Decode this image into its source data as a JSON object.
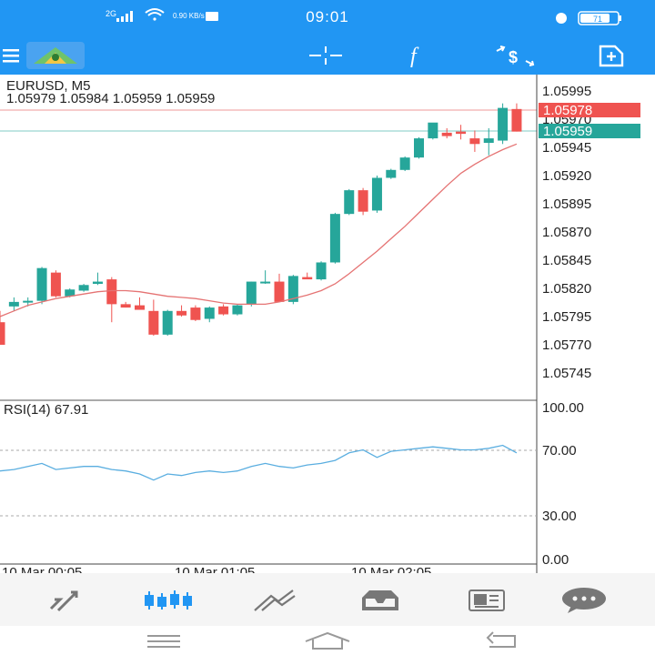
{
  "status_bar": {
    "time": "09:01",
    "network": "2G",
    "speed": "0.90 KB/s",
    "battery": "71"
  },
  "toolbar": {
    "items": [
      {
        "name": "menu-icon"
      },
      {
        "name": "app-logo"
      },
      {
        "name": "crosshair-icon"
      },
      {
        "name": "indicators-icon"
      },
      {
        "name": "trade-icon"
      },
      {
        "name": "add-chart-icon"
      }
    ]
  },
  "chart_header": {
    "symbol": "EURUSD, M5",
    "ohlc": "1.05979 1.05984 1.05959 1.05959"
  },
  "chart_data": [
    {
      "type": "candlestick",
      "title": "EURUSD, M5",
      "y_ticks": [
        "1.05995",
        "1.05970",
        "1.05945",
        "1.05920",
        "1.05895",
        "1.05870",
        "1.05845",
        "1.05820",
        "1.05795",
        "1.05770",
        "1.05745"
      ],
      "ylim": [
        1.05725,
        1.0601
      ],
      "x_labels": [
        "10 Mar 00:05",
        "10 Mar 01:05",
        "10 Mar 02:05"
      ],
      "price_labels": [
        {
          "value": "1.05978",
          "color": "#ef5350"
        },
        {
          "value": "1.05959",
          "color": "#26a69a"
        }
      ],
      "candles": [
        {
          "o": 1.0579,
          "h": 1.058,
          "l": 1.0577,
          "c": 1.0577
        },
        {
          "o": 1.05804,
          "h": 1.05812,
          "l": 1.058,
          "c": 1.05808
        },
        {
          "o": 1.05808,
          "h": 1.05812,
          "l": 1.05804,
          "c": 1.05809
        },
        {
          "o": 1.05809,
          "h": 1.05839,
          "l": 1.05806,
          "c": 1.05838
        },
        {
          "o": 1.05834,
          "h": 1.05836,
          "l": 1.05812,
          "c": 1.05813
        },
        {
          "o": 1.05813,
          "h": 1.0582,
          "l": 1.05812,
          "c": 1.05819
        },
        {
          "o": 1.05818,
          "h": 1.05824,
          "l": 1.05817,
          "c": 1.05823
        },
        {
          "o": 1.05824,
          "h": 1.05834,
          "l": 1.05823,
          "c": 1.05826
        },
        {
          "o": 1.05828,
          "h": 1.0583,
          "l": 1.0579,
          "c": 1.05806
        },
        {
          "o": 1.05806,
          "h": 1.05808,
          "l": 1.05803,
          "c": 1.05803
        },
        {
          "o": 1.05805,
          "h": 1.05812,
          "l": 1.05802,
          "c": 1.05801
        },
        {
          "o": 1.058,
          "h": 1.0581,
          "l": 1.05778,
          "c": 1.05779
        },
        {
          "o": 1.05779,
          "h": 1.05801,
          "l": 1.05778,
          "c": 1.058
        },
        {
          "o": 1.058,
          "h": 1.05805,
          "l": 1.05795,
          "c": 1.05796
        },
        {
          "o": 1.05803,
          "h": 1.05805,
          "l": 1.05791,
          "c": 1.05792
        },
        {
          "o": 1.05793,
          "h": 1.05804,
          "l": 1.0579,
          "c": 1.05803
        },
        {
          "o": 1.05804,
          "h": 1.05806,
          "l": 1.05796,
          "c": 1.05797
        },
        {
          "o": 1.05797,
          "h": 1.05806,
          "l": 1.05796,
          "c": 1.05805
        },
        {
          "o": 1.05806,
          "h": 1.05826,
          "l": 1.05804,
          "c": 1.05826
        },
        {
          "o": 1.05826,
          "h": 1.05836,
          "l": 1.05824,
          "c": 1.05826
        },
        {
          "o": 1.05826,
          "h": 1.05833,
          "l": 1.05809,
          "c": 1.05808
        },
        {
          "o": 1.05808,
          "h": 1.05832,
          "l": 1.05806,
          "c": 1.05831
        },
        {
          "o": 1.0583,
          "h": 1.05834,
          "l": 1.05829,
          "c": 1.05828
        },
        {
          "o": 1.05828,
          "h": 1.05844,
          "l": 1.05827,
          "c": 1.05843
        },
        {
          "o": 1.05843,
          "h": 1.05887,
          "l": 1.05842,
          "c": 1.05886
        },
        {
          "o": 1.05886,
          "h": 1.05908,
          "l": 1.05885,
          "c": 1.05907
        },
        {
          "o": 1.05907,
          "h": 1.05909,
          "l": 1.05885,
          "c": 1.05888
        },
        {
          "o": 1.05889,
          "h": 1.0592,
          "l": 1.05887,
          "c": 1.05918
        },
        {
          "o": 1.05918,
          "h": 1.05926,
          "l": 1.05917,
          "c": 1.05925
        },
        {
          "o": 1.05925,
          "h": 1.05937,
          "l": 1.05924,
          "c": 1.05936
        },
        {
          "o": 1.05936,
          "h": 1.05954,
          "l": 1.05935,
          "c": 1.05953
        },
        {
          "o": 1.05953,
          "h": 1.05966,
          "l": 1.05952,
          "c": 1.05967
        },
        {
          "o": 1.05958,
          "h": 1.05962,
          "l": 1.05953,
          "c": 1.05955
        },
        {
          "o": 1.05959,
          "h": 1.05965,
          "l": 1.05952,
          "c": 1.05957
        },
        {
          "o": 1.05953,
          "h": 1.0596,
          "l": 1.05941,
          "c": 1.05948
        },
        {
          "o": 1.05949,
          "h": 1.05962,
          "l": 1.05938,
          "c": 1.05953
        },
        {
          "o": 1.05951,
          "h": 1.05984,
          "l": 1.05948,
          "c": 1.0598
        },
        {
          "o": 1.05979,
          "h": 1.05984,
          "l": 1.05959,
          "c": 1.05959
        }
      ],
      "ma": [
        1.05795,
        1.058,
        1.05805,
        1.05808,
        1.05811,
        1.05813,
        1.05815,
        1.05817,
        1.05818,
        1.05818,
        1.05817,
        1.05815,
        1.05813,
        1.05812,
        1.05811,
        1.05809,
        1.05807,
        1.05806,
        1.05806,
        1.05806,
        1.05808,
        1.05811,
        1.05814,
        1.05818,
        1.05824,
        1.05833,
        1.05843,
        1.05853,
        1.05864,
        1.05875,
        1.05887,
        1.05899,
        1.05911,
        1.05922,
        1.0593,
        1.05937,
        1.05943,
        1.05948
      ]
    },
    {
      "type": "line",
      "title": "RSI(14) 67.91",
      "y_ticks": [
        "100.00",
        "70.00",
        "30.00",
        "0.00"
      ],
      "ylim": [
        0,
        100
      ],
      "levels": [
        70,
        30
      ],
      "values": [
        58,
        59,
        61,
        63,
        59,
        60,
        61,
        61,
        59,
        58,
        56,
        52,
        56,
        55,
        57,
        58,
        57,
        58,
        61,
        63,
        61,
        60,
        62,
        63,
        65,
        70,
        72,
        67,
        71,
        72,
        73,
        74,
        73,
        72,
        72,
        73,
        75,
        70
      ]
    }
  ],
  "tab_bar": {
    "items": [
      {
        "name": "tab-quotes"
      },
      {
        "name": "tab-chart"
      },
      {
        "name": "tab-trade"
      },
      {
        "name": "tab-history"
      },
      {
        "name": "tab-news"
      },
      {
        "name": "tab-messages"
      }
    ]
  },
  "colors": {
    "bull": "#26a69a",
    "bear": "#ef5350",
    "ma": "#e57373",
    "rsi": "#5aaee0",
    "accent": "#2196f3"
  }
}
